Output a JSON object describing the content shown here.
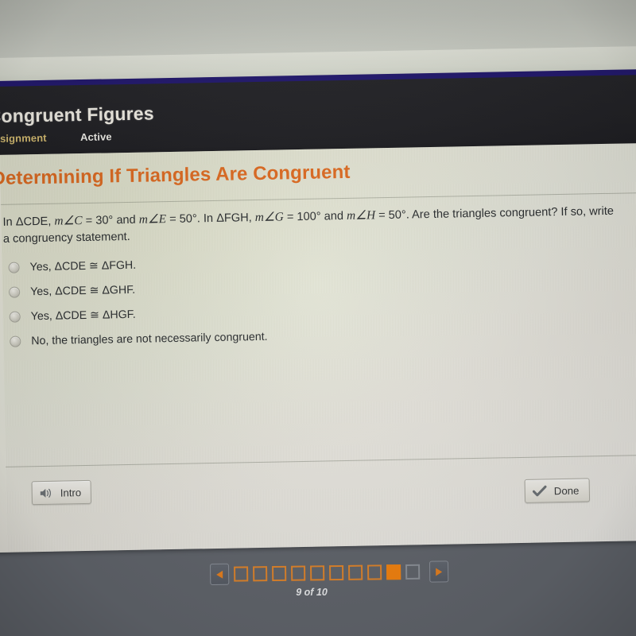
{
  "header": {
    "course_title": "Congruent Figures",
    "assignment_label": "Assignment",
    "status_label": "Active"
  },
  "content": {
    "title": "Determining If Triangles Are Congruent",
    "question_segments": {
      "s1": "In ΔCDE, ",
      "m1": "m∠C",
      "s2": " = 30° and ",
      "m2": "m∠E",
      "s3": " = 50°. In ΔFGH, ",
      "m3": "m∠G",
      "s4": " = 100° and ",
      "m4": "m∠H",
      "s5": " = 50°. Are the triangles congruent? If so, write a congruency statement."
    },
    "options": [
      {
        "label": "Yes, ΔCDE ≅ ΔFGH.",
        "selected": false
      },
      {
        "label": "Yes, ΔCDE ≅ ΔGHF.",
        "selected": false
      },
      {
        "label": "Yes, ΔCDE ≅ ΔHGF.",
        "selected": false
      },
      {
        "label": "No, the triangles are not necessarily congruent.",
        "selected": false
      }
    ]
  },
  "footer": {
    "intro_label": "Intro",
    "intro_icon": "speaker-icon",
    "done_label": "Done",
    "done_icon": "check-icon"
  },
  "pagination": {
    "prev_icon": "triangle-left-icon",
    "next_icon": "triangle-right-icon",
    "current_page": 9,
    "total_pages": 10,
    "page_count_label": "9 of 10",
    "boxes": [
      {
        "state": "visited"
      },
      {
        "state": "visited"
      },
      {
        "state": "visited"
      },
      {
        "state": "visited"
      },
      {
        "state": "visited"
      },
      {
        "state": "visited"
      },
      {
        "state": "visited"
      },
      {
        "state": "visited"
      },
      {
        "state": "current"
      },
      {
        "state": "unvisited"
      }
    ]
  },
  "colors": {
    "accent_orange": "#dd6b22",
    "pager_orange": "#f58410",
    "assignment_gold": "#d6bd72",
    "header_dark": "#232327",
    "panel_bg": "#e8e7db",
    "desk_blue": "#241a6e"
  }
}
